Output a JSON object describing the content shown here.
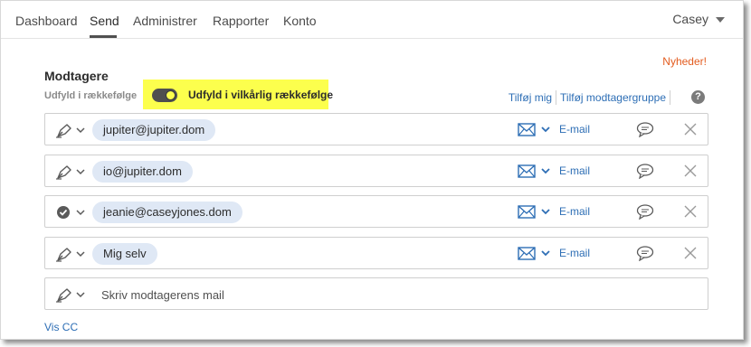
{
  "nav": {
    "items": [
      {
        "label": "Dashboard"
      },
      {
        "label": "Send"
      },
      {
        "label": "Administrer"
      },
      {
        "label": "Rapporter"
      },
      {
        "label": "Konto"
      }
    ],
    "active": "Send",
    "user": "Casey"
  },
  "news_label": "Nyheder!",
  "recipients_section": {
    "title": "Modtagere",
    "order_label": "Udfyld i rækkefølge",
    "toggle_label": "Udfyld i vilkårlig rækkefølge",
    "toggle_on": true,
    "add_me": "Tilføj mig",
    "add_group": "Tilføj modtagergruppe",
    "help": "?"
  },
  "recipients": [
    {
      "role_icon": "pen-icon",
      "email": "jupiter@jupiter.dom",
      "delivery": "E-mail"
    },
    {
      "role_icon": "pen-icon",
      "email": "io@jupiter.dom",
      "delivery": "E-mail"
    },
    {
      "role_icon": "check-circle-icon",
      "email": "jeanie@caseyjones.dom",
      "delivery": "E-mail"
    },
    {
      "role_icon": "pen-icon",
      "email": "Mig selv",
      "delivery": "E-mail"
    }
  ],
  "new_recipient": {
    "placeholder": "Skriv modtagerens mail",
    "role_icon": "pen-icon"
  },
  "cc_link": "Vis CC",
  "colors": {
    "accent_blue": "#2d6eb5",
    "highlight_yellow": "#fcff4d",
    "news_orange": "#e35c1f",
    "chip_bg": "#dfe8f5"
  }
}
